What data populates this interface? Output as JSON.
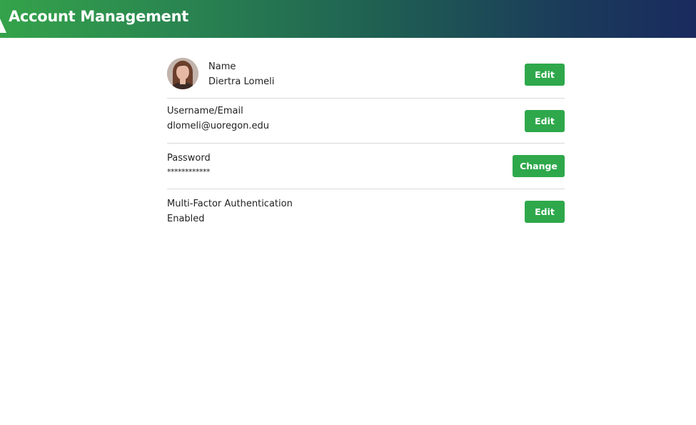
{
  "header": {
    "title": "Account Management",
    "logo_icon": "mountain-logo-icon"
  },
  "colors": {
    "header_gradient_start": "#34a34a",
    "header_gradient_end": "#1a2a5e",
    "button": "#2ea84b",
    "divider": "#d9d9d9"
  },
  "rows": {
    "name": {
      "label": "Name",
      "value": "Diertra Lomeli",
      "button": "Edit"
    },
    "username": {
      "label": "Username/Email",
      "value": "dlomeli@uoregon.edu",
      "button": "Edit"
    },
    "password": {
      "label": "Password",
      "value": "************",
      "button": "Change"
    },
    "mfa": {
      "label": "Multi-Factor Authentication",
      "value": "Enabled",
      "button": "Edit"
    }
  }
}
